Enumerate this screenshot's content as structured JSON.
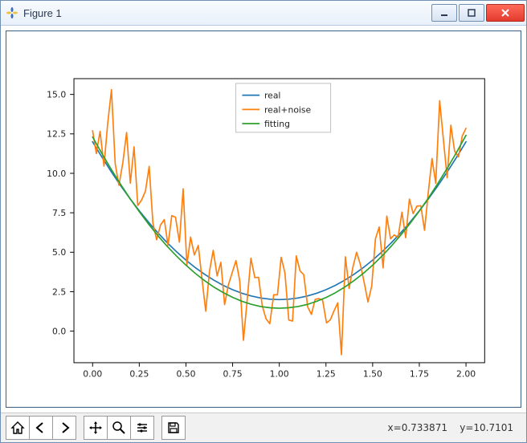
{
  "window": {
    "title": "Figure 1"
  },
  "toolbar": {
    "coords": "x=0.733871    y=10.7101"
  },
  "legend": {
    "items": [
      "real",
      "real+noise",
      "fitting"
    ]
  },
  "chart_data": {
    "type": "line",
    "xlabel": "",
    "ylabel": "",
    "title": "",
    "xlim": [
      -0.1,
      2.1
    ],
    "ylim": [
      -2.0,
      16.0
    ],
    "xticks": [
      0.0,
      0.25,
      0.5,
      0.75,
      1.0,
      1.25,
      1.5,
      1.75,
      2.0
    ],
    "yticks": [
      0.0,
      2.5,
      5.0,
      7.5,
      10.0,
      12.5,
      15.0
    ],
    "series": [
      {
        "name": "real",
        "color": "#1f77b4",
        "x": [
          0.0,
          0.05,
          0.1,
          0.15,
          0.2,
          0.25,
          0.3,
          0.35,
          0.4,
          0.45,
          0.5,
          0.55,
          0.6,
          0.65,
          0.7,
          0.75,
          0.8,
          0.85,
          0.9,
          0.95,
          1.0,
          1.05,
          1.1,
          1.15,
          1.2,
          1.25,
          1.3,
          1.35,
          1.4,
          1.45,
          1.5,
          1.55,
          1.6,
          1.65,
          1.7,
          1.75,
          1.8,
          1.85,
          1.9,
          1.95,
          2.0
        ],
        "y": [
          12.0,
          11.025,
          10.1,
          9.225,
          8.4,
          7.625,
          6.9,
          6.225,
          5.6,
          5.025,
          4.5,
          4.025,
          3.6,
          3.225,
          2.9,
          2.625,
          2.4,
          2.225,
          2.1,
          2.025,
          2.0,
          2.025,
          2.1,
          2.225,
          2.4,
          2.625,
          2.9,
          3.225,
          3.6,
          4.025,
          4.5,
          5.025,
          5.6,
          6.225,
          6.9,
          7.625,
          8.4,
          9.225,
          10.1,
          11.025,
          12.0
        ]
      },
      {
        "name": "real+noise",
        "color": "#ff7f0e",
        "x": [
          0.0,
          0.02,
          0.04,
          0.061,
          0.081,
          0.101,
          0.121,
          0.141,
          0.162,
          0.182,
          0.202,
          0.222,
          0.242,
          0.263,
          0.283,
          0.303,
          0.323,
          0.343,
          0.364,
          0.384,
          0.404,
          0.424,
          0.444,
          0.465,
          0.485,
          0.505,
          0.525,
          0.545,
          0.566,
          0.586,
          0.606,
          0.626,
          0.646,
          0.667,
          0.687,
          0.707,
          0.727,
          0.747,
          0.768,
          0.788,
          0.808,
          0.828,
          0.848,
          0.869,
          0.889,
          0.909,
          0.929,
          0.949,
          0.97,
          0.99,
          1.01,
          1.03,
          1.051,
          1.071,
          1.091,
          1.111,
          1.131,
          1.152,
          1.172,
          1.192,
          1.212,
          1.232,
          1.253,
          1.273,
          1.293,
          1.313,
          1.333,
          1.354,
          1.374,
          1.394,
          1.414,
          1.434,
          1.455,
          1.475,
          1.495,
          1.515,
          1.535,
          1.556,
          1.576,
          1.596,
          1.616,
          1.636,
          1.657,
          1.677,
          1.697,
          1.717,
          1.737,
          1.758,
          1.778,
          1.798,
          1.818,
          1.838,
          1.859,
          1.879,
          1.899,
          1.919,
          1.939,
          1.96,
          1.98,
          2.0
        ],
        "y": [
          12.7,
          11.25,
          12.66,
          10.46,
          13.18,
          15.3,
          10.61,
          9.24,
          10.68,
          12.59,
          9.38,
          11.68,
          7.96,
          8.32,
          8.87,
          10.44,
          6.86,
          5.79,
          6.73,
          7.07,
          5.44,
          7.32,
          7.22,
          5.64,
          9.02,
          4.19,
          5.96,
          4.83,
          5.43,
          3.3,
          1.26,
          3.78,
          5.12,
          3.5,
          4.36,
          1.68,
          2.92,
          3.68,
          4.47,
          3.2,
          -0.58,
          1.99,
          4.62,
          3.39,
          3.41,
          1.59,
          0.78,
          0.47,
          2.3,
          2.3,
          4.68,
          3.7,
          0.7,
          0.64,
          4.77,
          3.82,
          3.58,
          1.54,
          1.06,
          2.01,
          2.06,
          1.96,
          0.52,
          0.71,
          1.28,
          1.79,
          -1.49,
          4.71,
          2.7,
          4.04,
          5.0,
          4.24,
          3.06,
          1.85,
          2.85,
          5.85,
          6.6,
          4.01,
          7.29,
          5.85,
          6.1,
          5.93,
          7.54,
          5.92,
          8.37,
          7.45,
          7.92,
          7.95,
          6.39,
          8.79,
          10.94,
          9.36,
          14.6,
          12.14,
          9.72,
          13.05,
          11.41,
          11.04,
          12.37,
          12.85
        ]
      },
      {
        "name": "fitting",
        "color": "#2ca02c",
        "x": [
          0.0,
          0.05,
          0.1,
          0.15,
          0.2,
          0.25,
          0.3,
          0.35,
          0.4,
          0.45,
          0.5,
          0.55,
          0.6,
          0.65,
          0.7,
          0.75,
          0.8,
          0.85,
          0.9,
          0.95,
          1.0,
          1.05,
          1.1,
          1.15,
          1.2,
          1.25,
          1.3,
          1.35,
          1.4,
          1.45,
          1.5,
          1.55,
          1.6,
          1.65,
          1.7,
          1.75,
          1.8,
          1.85,
          1.9,
          1.95,
          2.0
        ],
        "y": [
          12.3,
          11.25,
          10.25,
          9.3,
          8.41,
          7.57,
          6.78,
          6.05,
          5.37,
          4.75,
          4.18,
          3.66,
          3.2,
          2.79,
          2.44,
          2.14,
          1.89,
          1.7,
          1.56,
          1.48,
          1.45,
          1.48,
          1.56,
          1.69,
          1.89,
          2.13,
          2.43,
          2.79,
          3.2,
          3.66,
          4.18,
          4.76,
          5.39,
          6.08,
          6.82,
          7.61,
          8.46,
          9.37,
          10.33,
          11.34,
          12.41
        ]
      }
    ]
  },
  "colors": {
    "axis_frame": "#000000",
    "close_btn": "#e33b2e",
    "window_border": "#6f8fb3"
  }
}
